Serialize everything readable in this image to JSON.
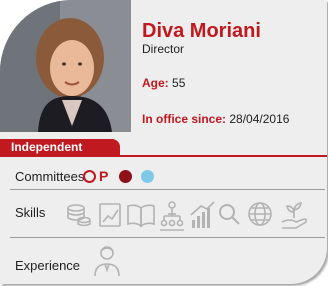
{
  "profile": {
    "name": "Diva Moriani",
    "role": "Director",
    "age_label": "Age:",
    "age_value": "55",
    "office_label": "In office since:",
    "office_value": "28/04/2016",
    "status_badge": "Independent"
  },
  "committees": {
    "label": "Committees",
    "chair_letter": "P",
    "icons": [
      "ring-icon",
      "dark-red-dot",
      "light-blue-dot"
    ],
    "colors": {
      "red": "#c0191f",
      "dark_red": "#8e1018",
      "light_blue": "#7fc8e8"
    }
  },
  "skills": {
    "label": "Skills",
    "icons": [
      "coins-icon",
      "chart-document-icon",
      "open-book-icon",
      "organization-icon",
      "growth-chart-icon",
      "magnifier-icon",
      "globe-icon",
      "hand-plant-icon"
    ]
  },
  "experience": {
    "label": "Experience",
    "icon": "person-icon"
  },
  "colors": {
    "accent": "#c0191f",
    "card": "#eeeeee",
    "icon_gray": "#b3b3b3"
  }
}
